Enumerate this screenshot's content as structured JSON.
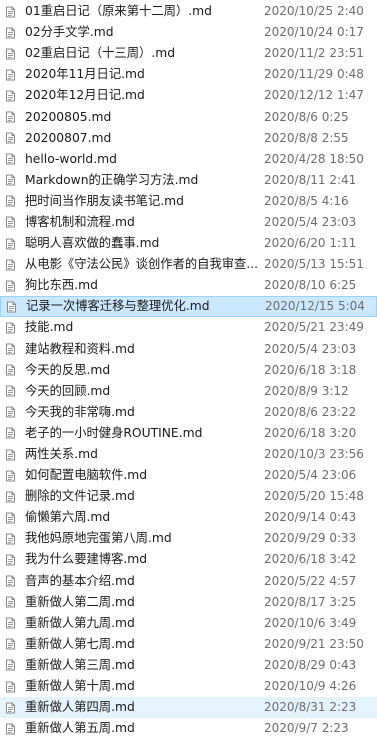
{
  "icon": "markdown-file-icon",
  "colors": {
    "hover_row": "#e5f3ff",
    "selected_row": "#cce8ff",
    "selected_border": "#99d1ff",
    "date_text": "#6d6d6d"
  },
  "files": [
    {
      "name": "01重启日记（原来第十二周）.md",
      "date": "2020/10/25 2:40"
    },
    {
      "name": "02分手文学.md",
      "date": "2020/10/24 0:17"
    },
    {
      "name": "02重启日记（十三周）.md",
      "date": "2020/11/2 23:51"
    },
    {
      "name": "2020年11月日记.md",
      "date": "2020/11/29 0:48"
    },
    {
      "name": "2020年12月日记.md",
      "date": "2020/12/12 1:47"
    },
    {
      "name": "20200805.md",
      "date": "2020/8/6 0:25"
    },
    {
      "name": "20200807.md",
      "date": "2020/8/8 2:55"
    },
    {
      "name": "hello-world.md",
      "date": "2020/4/28 18:50"
    },
    {
      "name": "Markdown的正确学习方法.md",
      "date": "2020/8/11 2:41"
    },
    {
      "name": "把时间当作朋友读书笔记.md",
      "date": "2020/8/5 4:16"
    },
    {
      "name": "博客机制和流程.md",
      "date": "2020/5/4 23:03"
    },
    {
      "name": "聪明人喜欢做的蠢事.md",
      "date": "2020/6/20 1:11"
    },
    {
      "name": "从电影《守法公民》谈创作者的自我审查...",
      "date": "2020/5/13 15:51"
    },
    {
      "name": "狗比东西.md",
      "date": "2020/8/10 6:25"
    },
    {
      "name": "记录一次博客迁移与整理优化.md",
      "date": "2020/12/15 5:04",
      "state": "selected"
    },
    {
      "name": "技能.md",
      "date": "2020/5/21 23:49"
    },
    {
      "name": "建站教程和资料.md",
      "date": "2020/5/4 23:03"
    },
    {
      "name": "今天的反思.md",
      "date": "2020/6/18 3:18"
    },
    {
      "name": "今天的回顾.md",
      "date": "2020/8/9 3:12"
    },
    {
      "name": "今天我的非常嗨.md",
      "date": "2020/8/6 23:22"
    },
    {
      "name": "老子的一小时健身ROUTINE.md",
      "date": "2020/6/18 3:20"
    },
    {
      "name": "两性关系.md",
      "date": "2020/10/3 23:56"
    },
    {
      "name": "如何配置电脑软件.md",
      "date": "2020/5/4 23:06"
    },
    {
      "name": "删除的文件记录.md",
      "date": "2020/5/20 15:48"
    },
    {
      "name": "偷懒第六周.md",
      "date": "2020/9/14 0:43"
    },
    {
      "name": "我他妈原地完蛋第八周.md",
      "date": "2020/9/29 0:33"
    },
    {
      "name": "我为什么要建博客.md",
      "date": "2020/6/18 3:42"
    },
    {
      "name": "音声的基本介绍.md",
      "date": "2020/5/22 4:57"
    },
    {
      "name": "重新做人第二周.md",
      "date": "2020/8/17 3:25"
    },
    {
      "name": "重新做人第九周.md",
      "date": "2020/10/6 3:49"
    },
    {
      "name": "重新做人第七周.md",
      "date": "2020/9/21 23:50"
    },
    {
      "name": "重新做人第三周.md",
      "date": "2020/8/29 0:43"
    },
    {
      "name": "重新做人第十周.md",
      "date": "2020/10/9 4:26"
    },
    {
      "name": "重新做人第四周.md",
      "date": "2020/8/31 2:23",
      "state": "hover"
    },
    {
      "name": "重新做人第五周.md",
      "date": "2020/9/7 2:23"
    }
  ]
}
